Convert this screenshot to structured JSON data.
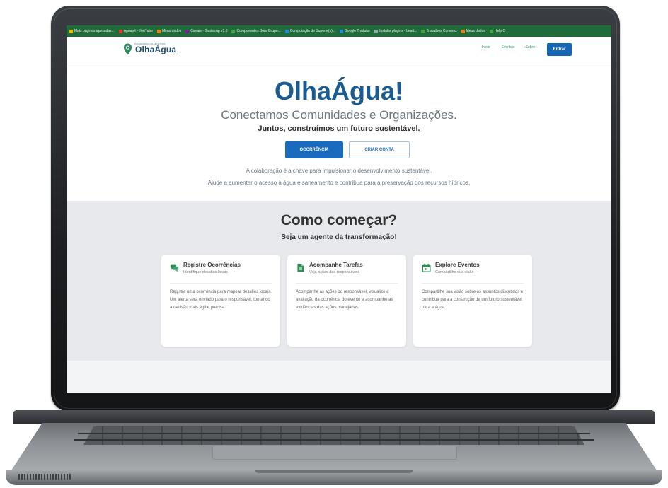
{
  "bookmarks": [
    {
      "label": "Mais páginas apesadas...",
      "color": "#f4b400"
    },
    {
      "label": "Aguapé - YouTube",
      "color": "#e53935"
    },
    {
      "label": "Meus dados",
      "color": "#f57c00"
    },
    {
      "label": "Canais - Bootstrap v5.0",
      "color": "#7b1fa2"
    },
    {
      "label": "Componentes Bom Grupo...",
      "color": "#43a047"
    },
    {
      "label": "Computação de Suporte(s)...",
      "color": "#1e88e5"
    },
    {
      "label": "Google Tradutor",
      "color": "#1e88e5"
    },
    {
      "label": "Instalar plugins - Leaft...",
      "color": "#90a4ae"
    },
    {
      "label": "Trabalhos Conexos",
      "color": "#43a047"
    },
    {
      "label": "Meus dados",
      "color": "#f57c00"
    },
    {
      "label": "Help O",
      "color": "#43a047"
    }
  ],
  "nav": {
    "logo_text": "OlhaÁgua",
    "logo_small": "PLATAFORMA COLABORATIVA",
    "links": [
      "Início",
      "Eventos",
      "Sobre"
    ],
    "enter_label": "Entrar"
  },
  "hero": {
    "title": "OlhaÁgua!",
    "subtitle": "Conectamos Comunidades e Organizações.",
    "tagline": "Juntos, construímos um futuro sustentável.",
    "primary_button": "OCORRÊNCIA",
    "secondary_button": "CRIAR CONTA",
    "collab_line1": "A colaboração é a chave para impulsionar o desenvolvimento sustentável.",
    "collab_line2": "Ajude a aumentar o acesso à água e saneamento e contribua para a preservação dos recursos hídricos."
  },
  "how": {
    "title": "Como começar?",
    "subtitle": "Seja um agente da transformação!",
    "cards": [
      {
        "title": "Registre Ocorrências",
        "subtitle": "Identifique desafios locais",
        "body": "Registre uma ocorrência para mapear desafios locais. Um alerta será enviado para o responsável, tornando a decisão mais ágil e precisa.",
        "icon": "chat-icon"
      },
      {
        "title": "Acompanhe Tarefas",
        "subtitle": "Veja ações dos responsáveis",
        "body": "Acompanhe as ações do responsável, visualize a avaliação da ocorrência do evento e acompanhe as evidências das ações planejadas.",
        "icon": "document-icon"
      },
      {
        "title": "Explore Eventos",
        "subtitle": "Compartilhe sua visão",
        "body": "Compartilhe sua visão sobre os assuntos discutidos e contribua para a construção de um futuro sustentável para a água.",
        "icon": "calendar-icon"
      }
    ]
  },
  "colors": {
    "brand_blue": "#1a5c91",
    "button_blue": "#1a6bbf",
    "accent_green": "#2a8c5a",
    "bookmark_bar": "#1f6b3a"
  }
}
